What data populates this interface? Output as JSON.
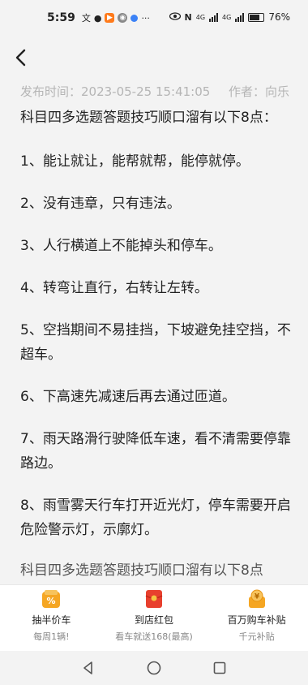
{
  "status_bar": {
    "time": "5:59",
    "network_left": "4G",
    "network_right": "4G",
    "battery": "76%",
    "icons": [
      "wechat-badge-icon",
      "video-app-icon",
      "app-icon",
      "dot-icon",
      "more-icon",
      "eye-icon",
      "nfc-icon",
      "signal-icon",
      "battery-icon"
    ]
  },
  "meta": {
    "publish_time": "发布时间：2023-05-25 15:41:05",
    "author": "作者：向乐"
  },
  "article": {
    "title_line": "科目四多选题答题技巧顺口溜有以下8点：",
    "items": [
      "1、能让就让，能帮就帮，能停就停。",
      "2、没有违章，只有违法。",
      "3、人行横道上不能掉头和停车。",
      "4、转弯让直行，右转让左转。",
      "5、空挡期间不易挂挡，下坡避免挂空挡，不超车。",
      "6、下高速先减速后再去通过匝道。",
      "7、雨天路滑行驶降低车速，看不清需要停靠路边。",
      "8、雨雪雾天行车打开近光灯，停车需要开启危险警示灯，示廓灯。"
    ],
    "partial_line": "科目四多选题答题技巧顺口溜有以下8点"
  },
  "promo": {
    "items": [
      {
        "title": "抽半价车",
        "subtitle": "每周1辆!",
        "icon": "half-price-tag-icon"
      },
      {
        "title": "到店红包",
        "subtitle": "看车就送168(最高)",
        "icon": "red-envelope-icon"
      },
      {
        "title": "百万购车补贴",
        "subtitle": "千元补贴",
        "icon": "subsidy-coin-icon"
      }
    ],
    "colors": {
      "accent": "#f5a623",
      "red": "#e8402e"
    }
  }
}
